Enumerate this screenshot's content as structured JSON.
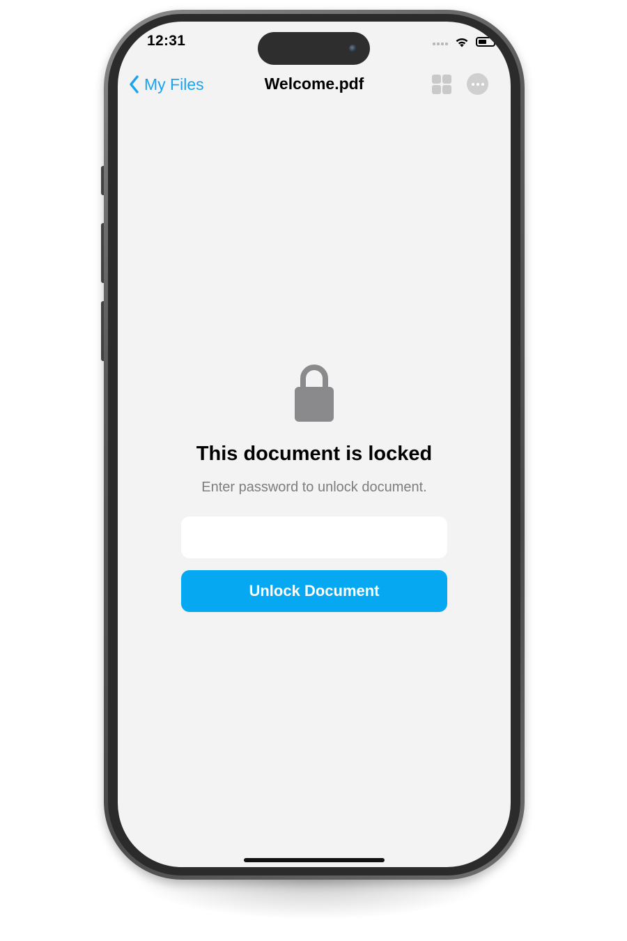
{
  "status_bar": {
    "time": "12:31"
  },
  "nav": {
    "back_label": "My Files",
    "title": "Welcome.pdf",
    "grid_icon": "grid-icon",
    "more_icon": "ellipsis-circle-icon"
  },
  "locked": {
    "icon": "lock-icon",
    "title": "This document is locked",
    "subtitle": "Enter password to unlock document.",
    "password_value": "",
    "password_placeholder": "",
    "button_label": "Unlock Document"
  },
  "colors": {
    "accent": "#1aa3ef",
    "button": "#06a8f2",
    "screen_background": "#f3f3f3",
    "icon_gray": "#8a8a8c",
    "subtitle_gray": "#7d7d7d"
  }
}
